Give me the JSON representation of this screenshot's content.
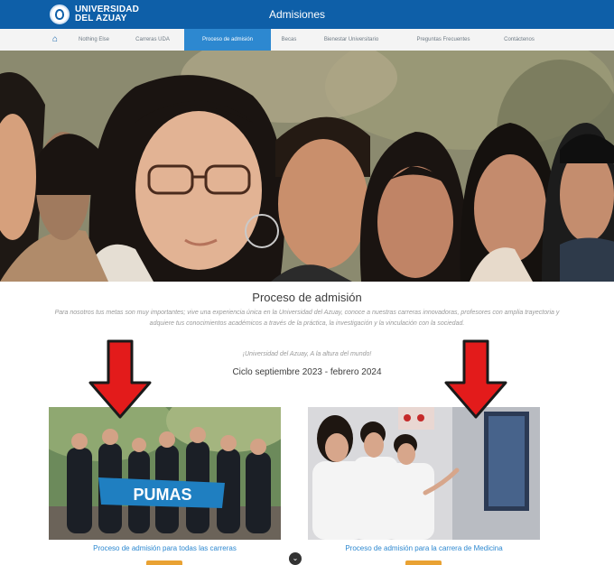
{
  "header": {
    "logo_line1": "UNIVERSIDAD",
    "logo_line2": "DEL AZUAY",
    "site_title": "Admisiones"
  },
  "nav": {
    "home_icon": "home-icon",
    "items": [
      {
        "label": "Nothing Else",
        "active": false
      },
      {
        "label": "Carreras UDA",
        "active": false
      },
      {
        "label": "Proceso de admisión",
        "active": true
      },
      {
        "label": "Becas",
        "active": false
      },
      {
        "label": "Bienestar Universitario",
        "active": false
      },
      {
        "label": "Preguntas Frecuentes",
        "active": false
      },
      {
        "label": "Contáctenos",
        "active": false
      }
    ]
  },
  "main": {
    "heading": "Proceso de admisión",
    "intro": "Para nosotros tus metas son muy importantes; vive una experiencia única en la Universidad del Azuay, conoce a nuestras carreras innovadoras, profesores con amplia trayectoria y adquiere tus conocimientos académicos a través de la práctica, la investigación y la vinculación con la sociedad.",
    "slogan": "¡Universidad del Azuay, A la altura del mundo!",
    "cycle": "Ciclo septiembre 2023 - febrero 2024"
  },
  "cards": [
    {
      "caption": "Proceso de admisión para todas las carreras",
      "banner": "PUMAS"
    },
    {
      "caption": "Proceso de admisión para la carrera de Medicina"
    }
  ],
  "colors": {
    "brand_blue": "#0e5fa8",
    "nav_active": "#2d88d0",
    "arrow_red": "#e31b1b",
    "accent_orange": "#e9a233"
  }
}
